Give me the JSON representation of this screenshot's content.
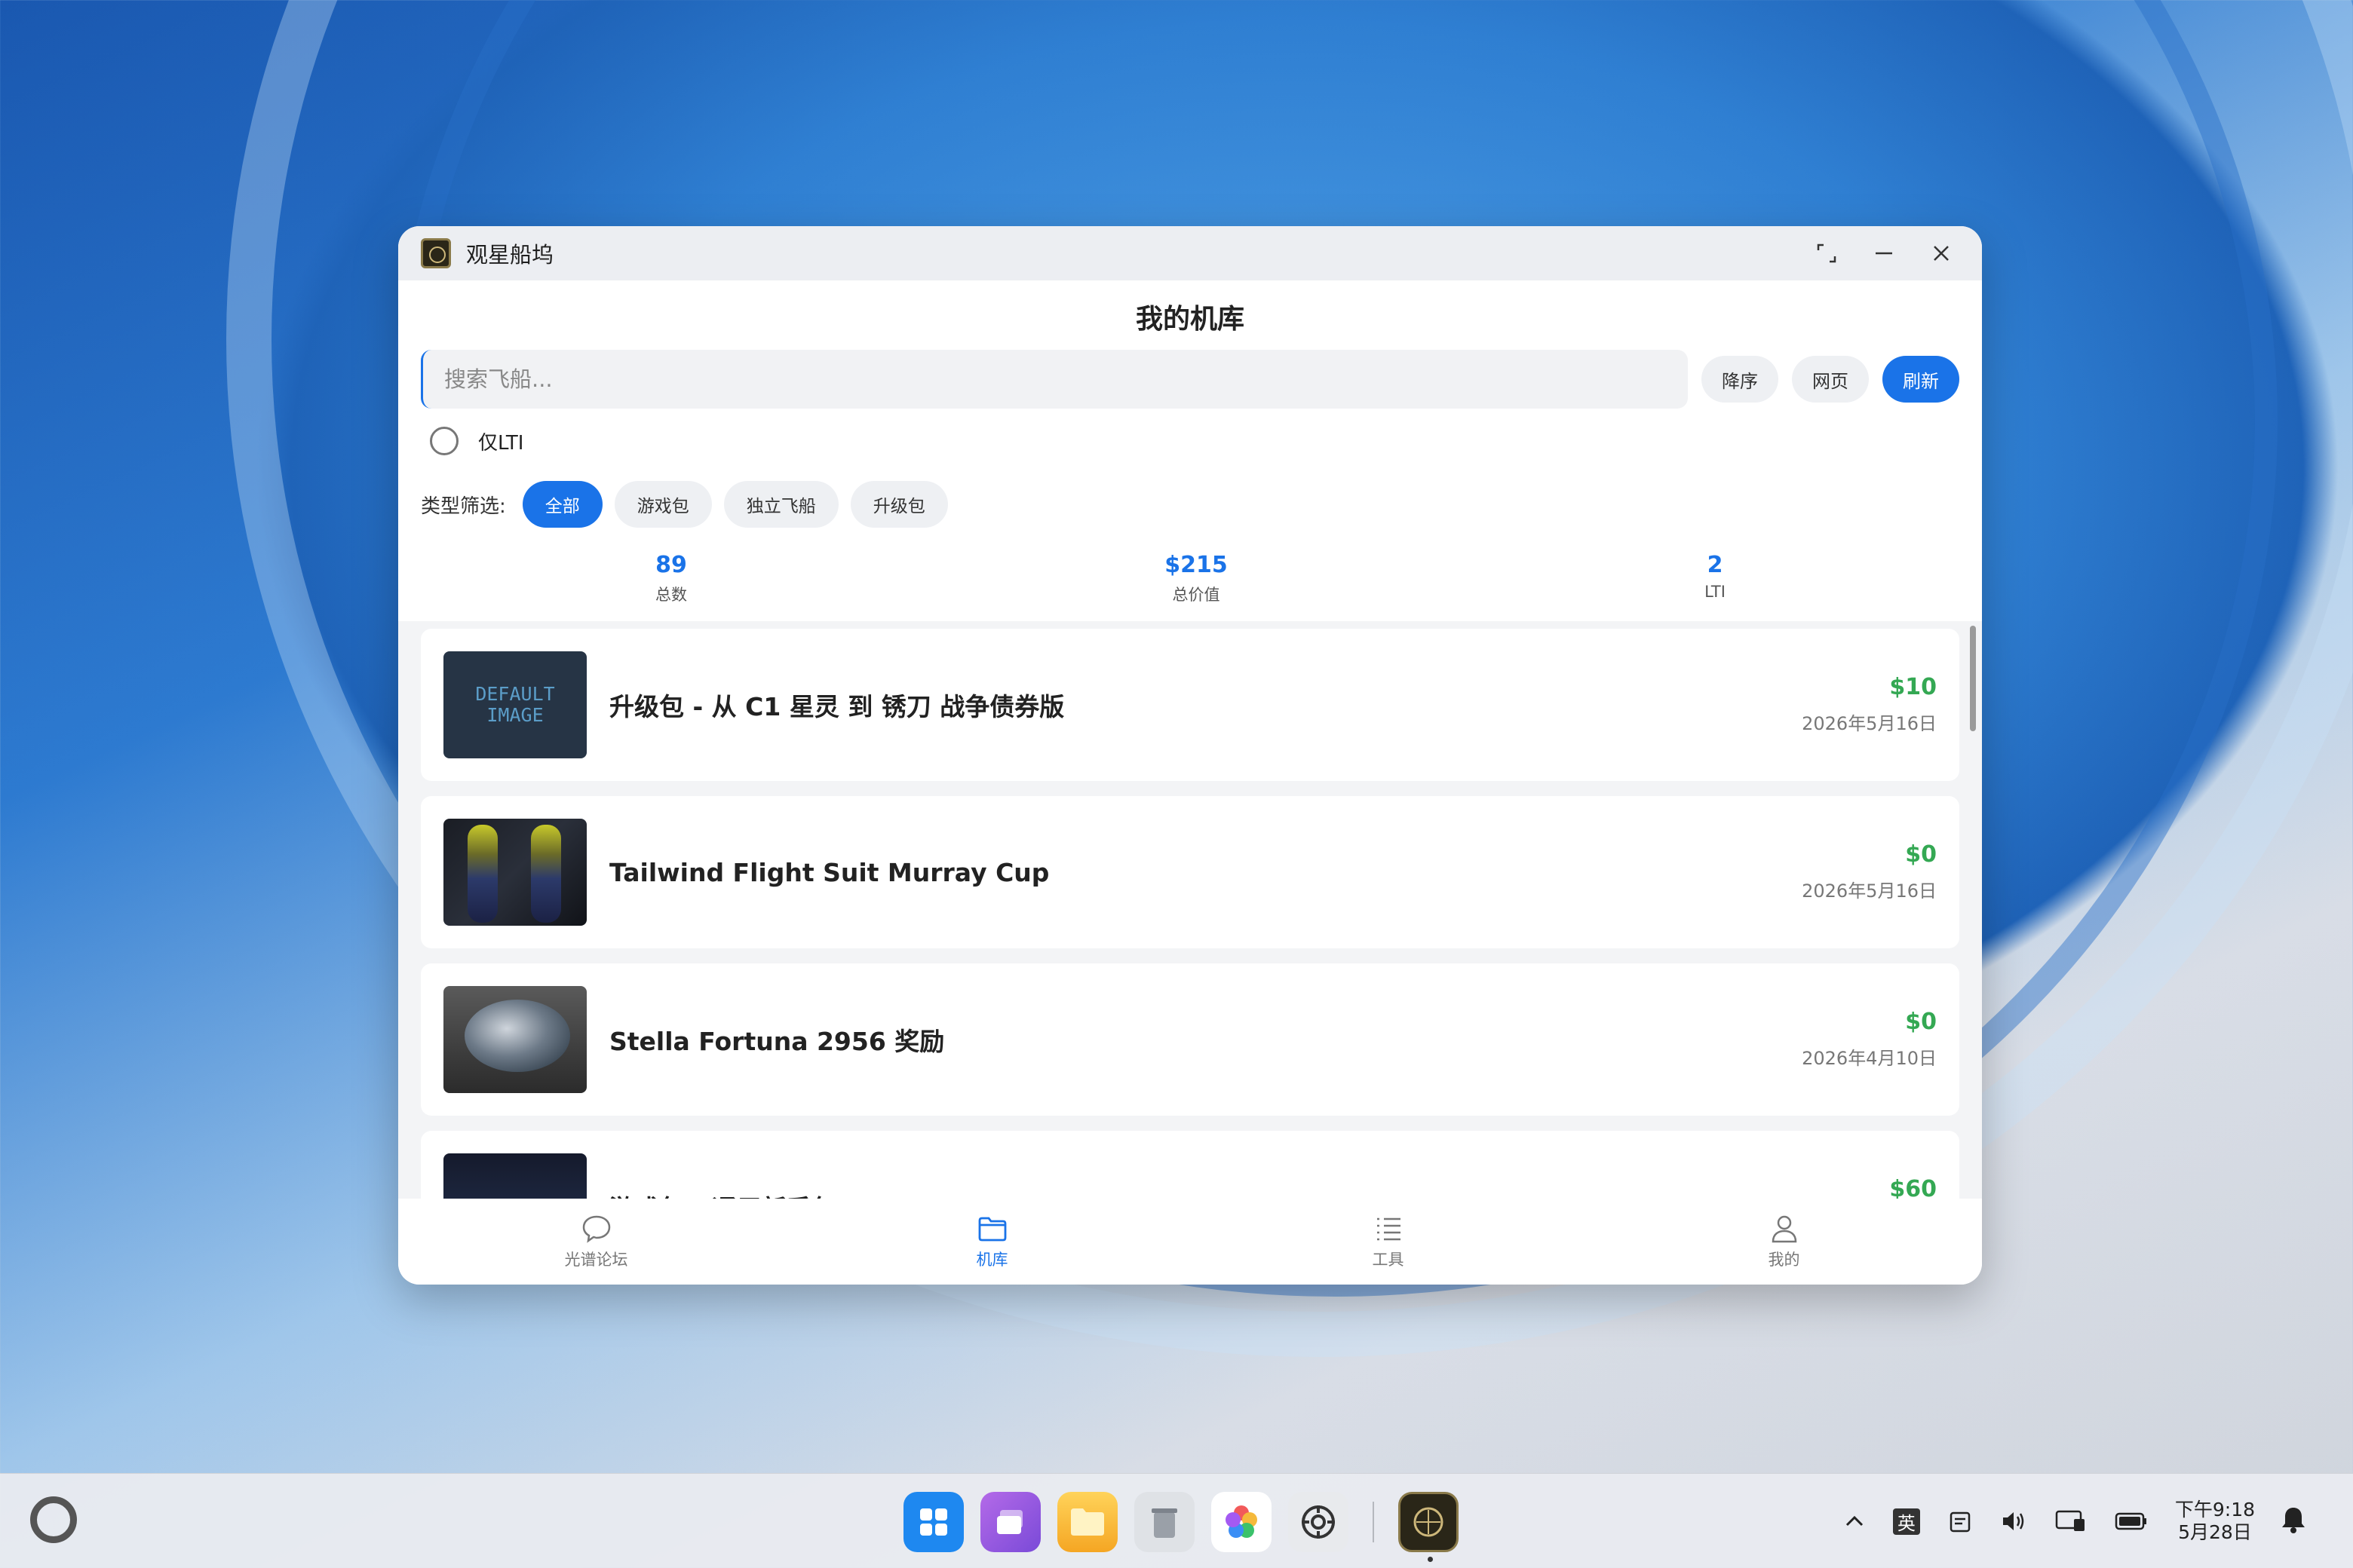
{
  "window": {
    "title": "观星船坞",
    "page_title": "我的机库"
  },
  "search": {
    "placeholder": "搜索飞船..."
  },
  "toolbar": {
    "sort_label": "降序",
    "web_label": "网页",
    "refresh_label": "刷新"
  },
  "filters": {
    "lti_only_label": "仅LTI",
    "type_label": "类型筛选:",
    "chips": [
      {
        "label": "全部",
        "active": true
      },
      {
        "label": "游戏包",
        "active": false
      },
      {
        "label": "独立飞船",
        "active": false
      },
      {
        "label": "升级包",
        "active": false
      }
    ]
  },
  "stats": [
    {
      "value": "89",
      "label": "总数"
    },
    {
      "value": "$215",
      "label": "总价值"
    },
    {
      "value": "2",
      "label": "LTI"
    }
  ],
  "items": [
    {
      "title": "升级包 - 从 C1 星灵 到 锈刀 战争债券版",
      "price": "$10",
      "date": "2026年5月16日",
      "image": "default-image",
      "image_text": "DEFAULT IMAGE"
    },
    {
      "title": "Tailwind Flight Suit Murray Cup",
      "price": "$0",
      "date": "2026年5月16日",
      "image": "flight-suit"
    },
    {
      "title": "Stella Fortuna 2956 奖励",
      "price": "$0",
      "date": "2026年4月10日",
      "image": "helmet"
    },
    {
      "title": "游戏包 - 通用新手包",
      "price": "$60",
      "date": "",
      "image": "game-package"
    }
  ],
  "nav": [
    {
      "label": "光谱论坛",
      "icon": "chat-bubble-icon",
      "active": false
    },
    {
      "label": "机库",
      "icon": "folder-icon",
      "active": true
    },
    {
      "label": "工具",
      "icon": "list-icon",
      "active": false
    },
    {
      "label": "我的",
      "icon": "person-icon",
      "active": false
    }
  ],
  "taskbar": {
    "ime_label": "英",
    "time": "下午9:18",
    "date": "5月28日"
  },
  "colors": {
    "accent": "#1a73e8",
    "price": "#34a853"
  }
}
